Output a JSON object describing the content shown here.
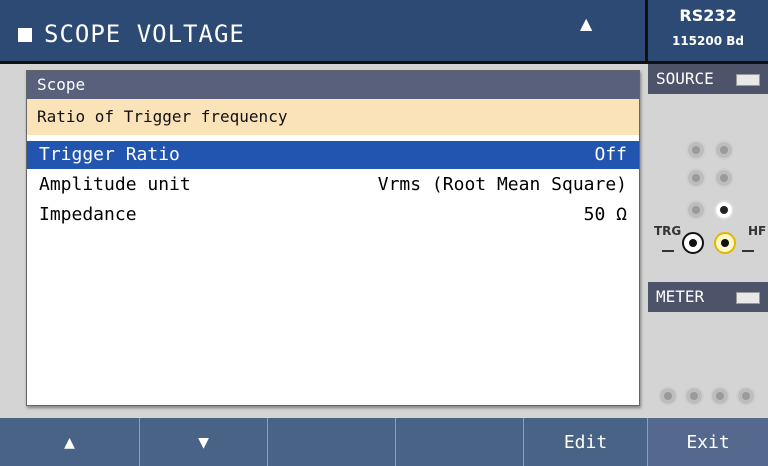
{
  "header": {
    "title": "SCOPE VOLTAGE",
    "warning_icon": "warning-triangle-icon"
  },
  "status": {
    "interface": "RS232",
    "baud": "115200 Bd"
  },
  "panel": {
    "section": "Scope",
    "description": "Ratio of Trigger frequency",
    "rows": [
      {
        "label": "Trigger Ratio",
        "value": "Off",
        "selected": true
      },
      {
        "label": "Amplitude unit",
        "value": "Vrms (Root Mean Square)"
      },
      {
        "label": "Impedance",
        "value": "50 Ω"
      }
    ]
  },
  "side": {
    "source_label": "SOURCE",
    "meter_label": "METER",
    "trg_label": "TRG",
    "hf_label": "HF"
  },
  "softkeys": {
    "k1": "▲",
    "k2": "▼",
    "k3": "",
    "k4": "",
    "k5": "Edit",
    "k6": "Exit"
  },
  "colors": {
    "header_bg": "#2c4a74",
    "selected_bg": "#2155b0",
    "desc_bg": "#fbe3b9",
    "section_bg": "#58607c",
    "softkey_bg": "#486386"
  }
}
